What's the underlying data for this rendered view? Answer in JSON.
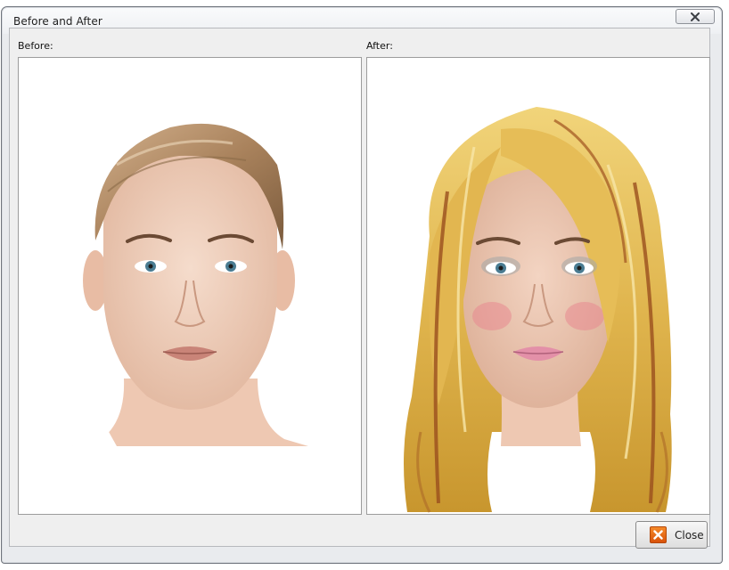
{
  "window": {
    "title": "Before and After"
  },
  "panels": {
    "before": {
      "label": "Before:",
      "image": "face-portrait-original"
    },
    "after": {
      "label": "After:",
      "image": "face-portrait-blonde-hair-makeover"
    }
  },
  "footer": {
    "close_label": "Close",
    "close_icon": "orange-x-icon"
  }
}
